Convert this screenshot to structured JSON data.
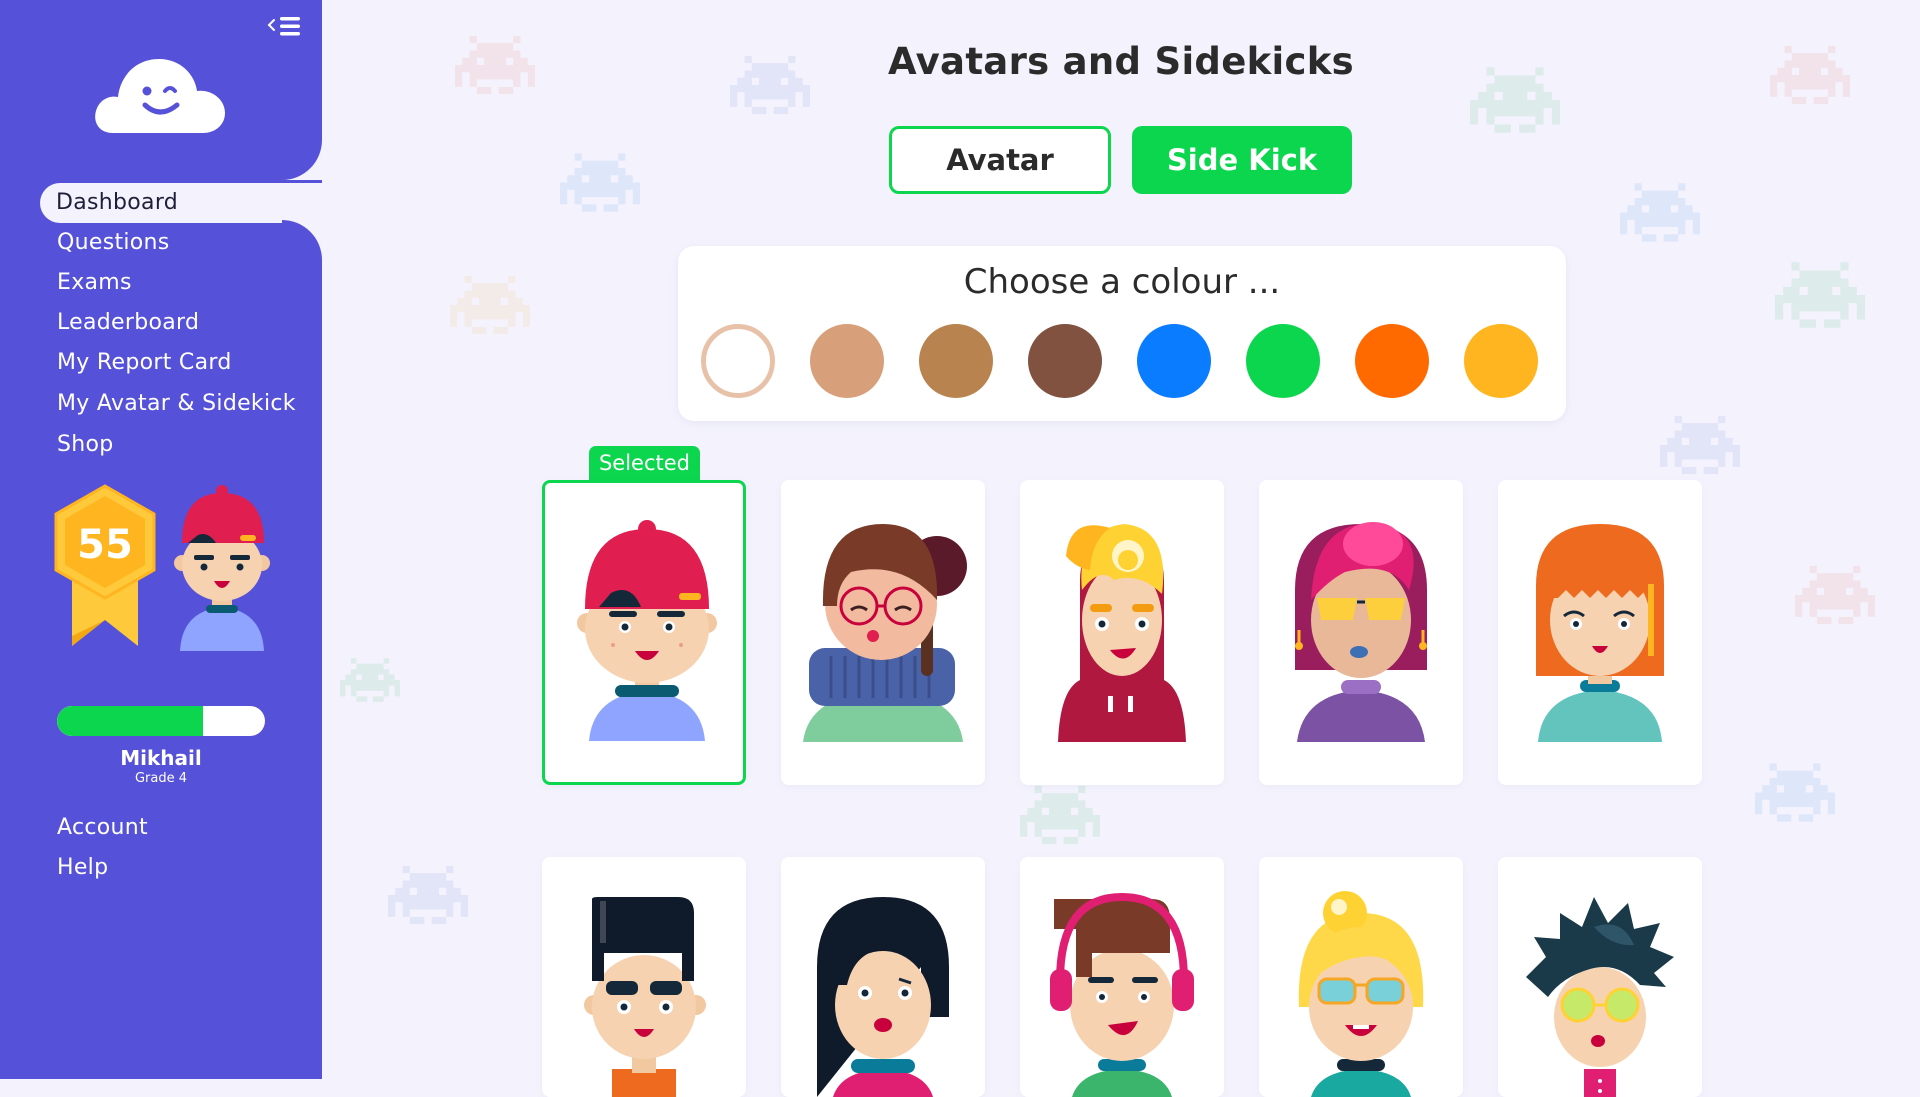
{
  "sidebar": {
    "items": [
      {
        "label": "Dashboard",
        "active": true
      },
      {
        "label": "Questions"
      },
      {
        "label": "Exams"
      },
      {
        "label": "Leaderboard"
      },
      {
        "label": "My Report Card"
      },
      {
        "label": "My Avatar & Sidekick"
      },
      {
        "label": "Shop"
      }
    ],
    "level": "55",
    "progress_fraction": 0.7,
    "user": {
      "name": "Mikhail",
      "grade": "Grade 4"
    },
    "bottom_items": [
      {
        "label": "Account"
      },
      {
        "label": "Help"
      }
    ]
  },
  "main": {
    "title": "Avatars and Sidekicks",
    "tabs": [
      {
        "label": "Avatar"
      },
      {
        "label": "Side Kick",
        "active": true
      }
    ],
    "colour_prompt": "Choose a colour ...",
    "colours": [
      "#ffffff",
      "#d8a07a",
      "#b8834f",
      "#80523f",
      "#0a7cff",
      "#0cd64e",
      "#ff6a00",
      "#ffb51f"
    ],
    "selected_colour_index": 0,
    "selected_label": "Selected",
    "avatars": [
      "red-cap-boy",
      "glasses-girl-bun",
      "blonde-hoodie-boy",
      "pink-hair-girl",
      "orange-hair-girl",
      "black-hair-boy",
      "bob-hair-girl",
      "headphones-boy",
      "blonde-glasses-girl",
      "spiky-hair-boy"
    ],
    "selected_avatar_index": 0
  },
  "icons": {
    "collapse": "collapse-menu-icon",
    "logo": "cloud-smile-logo",
    "level_badge": "ribbon-badge-icon"
  }
}
